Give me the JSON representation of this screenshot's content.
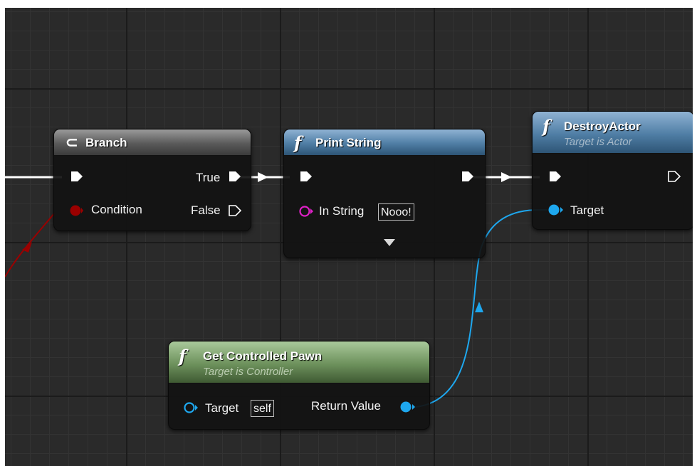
{
  "colors": {
    "exec": "#ffffff",
    "object_pin": "#1ea7ee",
    "string_pin": "#e020c8",
    "bool_pin": "#9b0000",
    "header_gray": "#6a6a6a",
    "header_blue": "#4f7ea5",
    "header_green": "#6d915c",
    "grid_background": "#2a2a2a"
  },
  "nodes": {
    "branch": {
      "icon": "branch-icon",
      "title": "Branch",
      "pins": {
        "condition": "Condition",
        "true": "True",
        "false": "False"
      }
    },
    "print_string": {
      "icon": "function-icon",
      "icon_glyph": "f",
      "title": "Print String",
      "pins": {
        "in_string": "In String"
      },
      "in_string_value": "Nooo!"
    },
    "destroy_actor": {
      "icon": "function-icon",
      "icon_glyph": "f",
      "title": "DestroyActor",
      "subtitle": "Target is Actor",
      "pins": {
        "target": "Target"
      }
    },
    "get_controlled_pawn": {
      "icon": "function-icon",
      "icon_glyph": "f",
      "title": "Get Controlled Pawn",
      "subtitle": "Target is Controller",
      "pins": {
        "target": "Target",
        "return_value": "Return Value"
      },
      "target_value": "self"
    }
  }
}
